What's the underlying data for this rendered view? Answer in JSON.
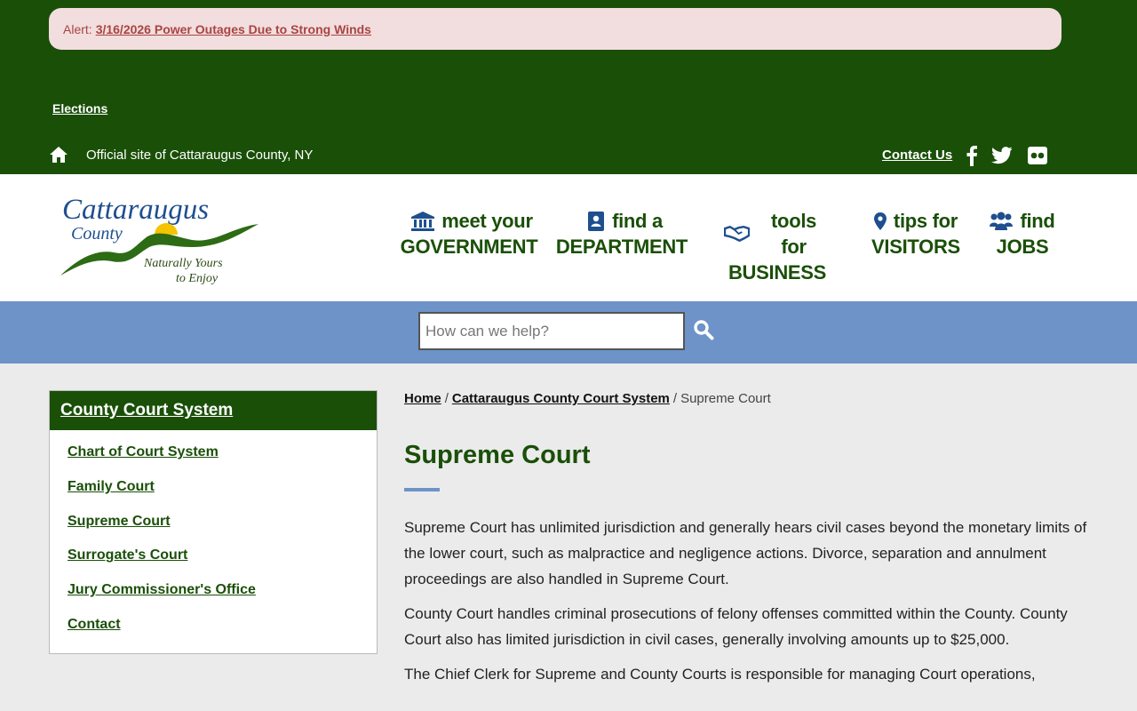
{
  "alert": {
    "prefix": "Alert:",
    "link": "3/16/2026 Power Outages Due to Strong Winds"
  },
  "topbar": {
    "elections": "Elections",
    "official": "Official site of Cattaraugus County, NY",
    "contact": "Contact Us",
    "icons": [
      "home-icon",
      "facebook-icon",
      "twitter-icon",
      "flickr-icon"
    ]
  },
  "logo": {
    "title": "Cattaraugus",
    "county": "County",
    "tag1": "Naturally Yours",
    "tag2": "to Enjoy"
  },
  "nav": [
    {
      "line1": "meet your",
      "line2": "GOVERNMENT",
      "icon": "building-icon",
      "dropdown": true
    },
    {
      "line1": "find a",
      "line2": "DEPARTMENT",
      "icon": "address-book-icon",
      "dropdown": true
    },
    {
      "line1": "tools for",
      "line2": "BUSINESS",
      "icon": "handshake-icon",
      "dropdown": false
    },
    {
      "line1": "tips for",
      "line2": "VISITORS",
      "icon": "map-pin-icon",
      "dropdown": false
    },
    {
      "line1": "find",
      "line2": "JOBS",
      "icon": "users-icon",
      "dropdown": false
    }
  ],
  "search": {
    "placeholder": "How can we help?"
  },
  "sidebar": {
    "title": "County Court System",
    "items": [
      "Chart of Court System",
      "Family Court",
      "Supreme Court",
      "Surrogate's Court",
      "Jury Commissioner's Office",
      "Contact"
    ]
  },
  "breadcrumb": {
    "home": "Home",
    "parent": "Cattaraugus County Court System",
    "sep": "/",
    "current": "Supreme Court"
  },
  "page": {
    "title": "Supreme Court",
    "paragraphs": [
      "Supreme Court has unlimited jurisdiction and generally hears civil cases beyond the monetary limits of the lower court, such as malpractice and negligence actions. Divorce, separation and annulment proceedings are also handled in Supreme Court.",
      "County Court handles criminal prosecutions of felony offenses committed within the County. County Court also has limited jurisdiction in civil cases, generally involving amounts up to $25,000.",
      "The Chief Clerk for Supreme and County Courts is responsible for managing Court operations,"
    ]
  },
  "colors": {
    "green": "#1a4f08",
    "blue": "#6d93c8",
    "alert_bg": "#f2dede",
    "alert_text": "#a94442"
  }
}
